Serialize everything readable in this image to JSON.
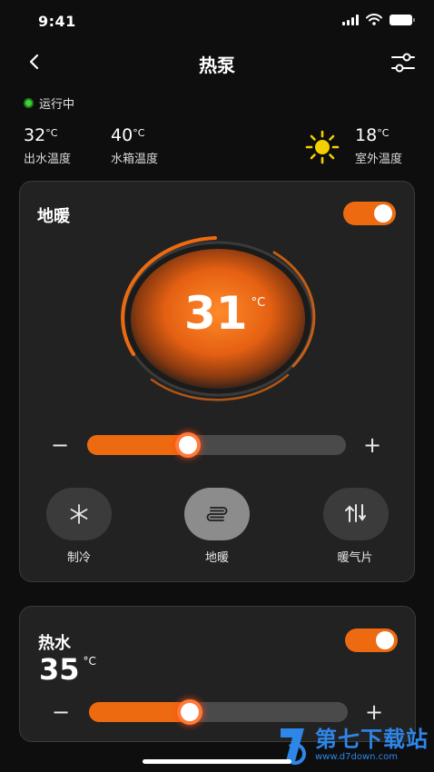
{
  "status_bar": {
    "time": "9:41"
  },
  "nav": {
    "title": "热泵"
  },
  "run_status": {
    "label": "运行中"
  },
  "temps": {
    "outlet": {
      "value": "32",
      "unit": "°C",
      "label": "出水温度"
    },
    "tank": {
      "value": "40",
      "unit": "°C",
      "label": "水箱温度"
    },
    "outdoor": {
      "value": "18",
      "unit": "°C",
      "label": "室外温度"
    }
  },
  "floor_heating_card": {
    "title": "地暖",
    "enabled": true,
    "set_temp": "31",
    "unit": "°C",
    "slider_fraction": 0.39,
    "minus": "−",
    "plus": "+",
    "modes": [
      {
        "label": "制冷",
        "icon": "snowflake-icon",
        "active": false
      },
      {
        "label": "地暖",
        "icon": "floor-heating-icon",
        "active": true
      },
      {
        "label": "暖气片",
        "icon": "radiator-icon",
        "active": false
      }
    ]
  },
  "hot_water_card": {
    "title": "热水",
    "enabled": true,
    "set_temp": "35",
    "unit": "°C",
    "slider_fraction": 0.39,
    "minus": "−",
    "plus": "+"
  },
  "watermark": {
    "main": "第七下载站",
    "sub": "www.d7down.com"
  },
  "colors": {
    "accent": "#ee6a10",
    "running": "#43d13b",
    "card_bg": "#222222",
    "page_bg": "#0e0e0e",
    "sun": "#f5d000",
    "watermark": "#2e86e8"
  }
}
